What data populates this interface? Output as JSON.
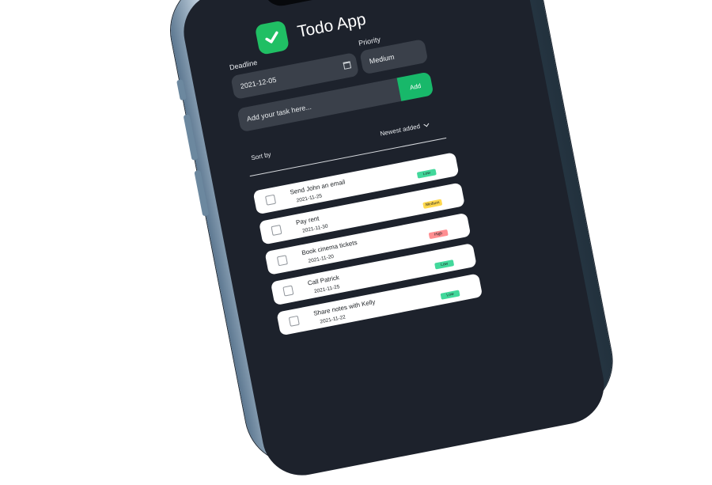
{
  "app": {
    "title": "Todo App",
    "brand_color": "#20BF64",
    "icon": "check-icon"
  },
  "form": {
    "deadline_label": "Deadline",
    "deadline_value": "2021-12-05",
    "priority_label": "Priority",
    "priority_value": "Medium",
    "task_placeholder": "Add your task here...",
    "add_label": "Add"
  },
  "sort": {
    "label": "Sort by",
    "value": "Newest added"
  },
  "colors": {
    "low": "#42D89B",
    "medium": "#FFD84D",
    "high": "#FF8E91",
    "screen": "#1D222C"
  },
  "tasks": [
    {
      "title": "Send John an email",
      "date": "2021-11-25",
      "priority": "Low"
    },
    {
      "title": "Pay rent",
      "date": "2021-11-30",
      "priority": "Medium"
    },
    {
      "title": "Book cinema tickets",
      "date": "2021-11-20",
      "priority": "High"
    },
    {
      "title": "Call Patrick",
      "date": "2021-11-25",
      "priority": "Low"
    },
    {
      "title": "Share notes with Kelly",
      "date": "2021-11-22",
      "priority": "Low"
    }
  ]
}
